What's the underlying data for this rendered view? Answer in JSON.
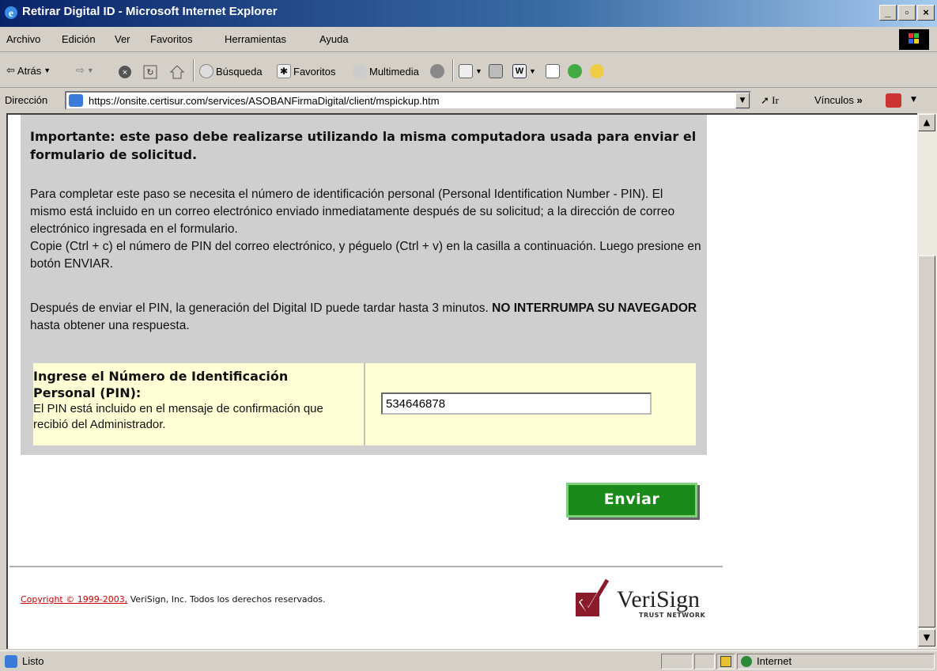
{
  "window": {
    "title": "Retirar Digital ID - Microsoft Internet Explorer"
  },
  "menu": [
    "Archivo",
    "Edición",
    "Ver",
    "Favoritos",
    "Herramientas",
    "Ayuda"
  ],
  "toolbar": {
    "back": "Atrás",
    "search": "Búsqueda",
    "favorites": "Favoritos",
    "media": "Multimedia"
  },
  "address": {
    "label": "Dirección",
    "url": "https://onsite.certisur.com/services/ASOBANFirmaDigital/client/mspickup.htm",
    "go": "Ir",
    "links": "Vínculos"
  },
  "content": {
    "heading": "Importante: este paso debe realizarse utilizando la misma computadora usada para enviar el formulario de solicitud.",
    "para1": "Para completar este paso se necesita el número de identificación personal (Personal Identification Number - PIN). El mismo está incluido en un correo electrónico enviado inmediatamente después de su solicitud; a la dirección de correo electrónico ingresada en el formulario.",
    "para1b": "Copie (Ctrl + c) el número de PIN del correo electrónico, y péguelo (Ctrl + v) en la casilla a continuación. Luego presione en botón ENVIAR.",
    "para2_start": "Después de enviar el PIN, la generación del Digital ID puede tardar hasta 3 minutos.",
    "para2_bold": "NO INTERRUMPA SU NAVEGADOR",
    "para2_end": "hasta obtener una respuesta.",
    "pin_title": "Ingrese el Número de Identificación Personal (PIN):",
    "pin_desc": "El PIN está incluido en el mensaje de confirmación que recibió del Administrador.",
    "pin_value": "534646878",
    "send_label": "Enviar",
    "copyright_link": "Copyright © 1999-2003,",
    "copyright_rest": "VeriSign, Inc. Todos los derechos reservados.",
    "logo_name": "VeriSign",
    "logo_tag": "TRUST NETWORK"
  },
  "status": {
    "text": "Listo",
    "zone": "Internet"
  }
}
